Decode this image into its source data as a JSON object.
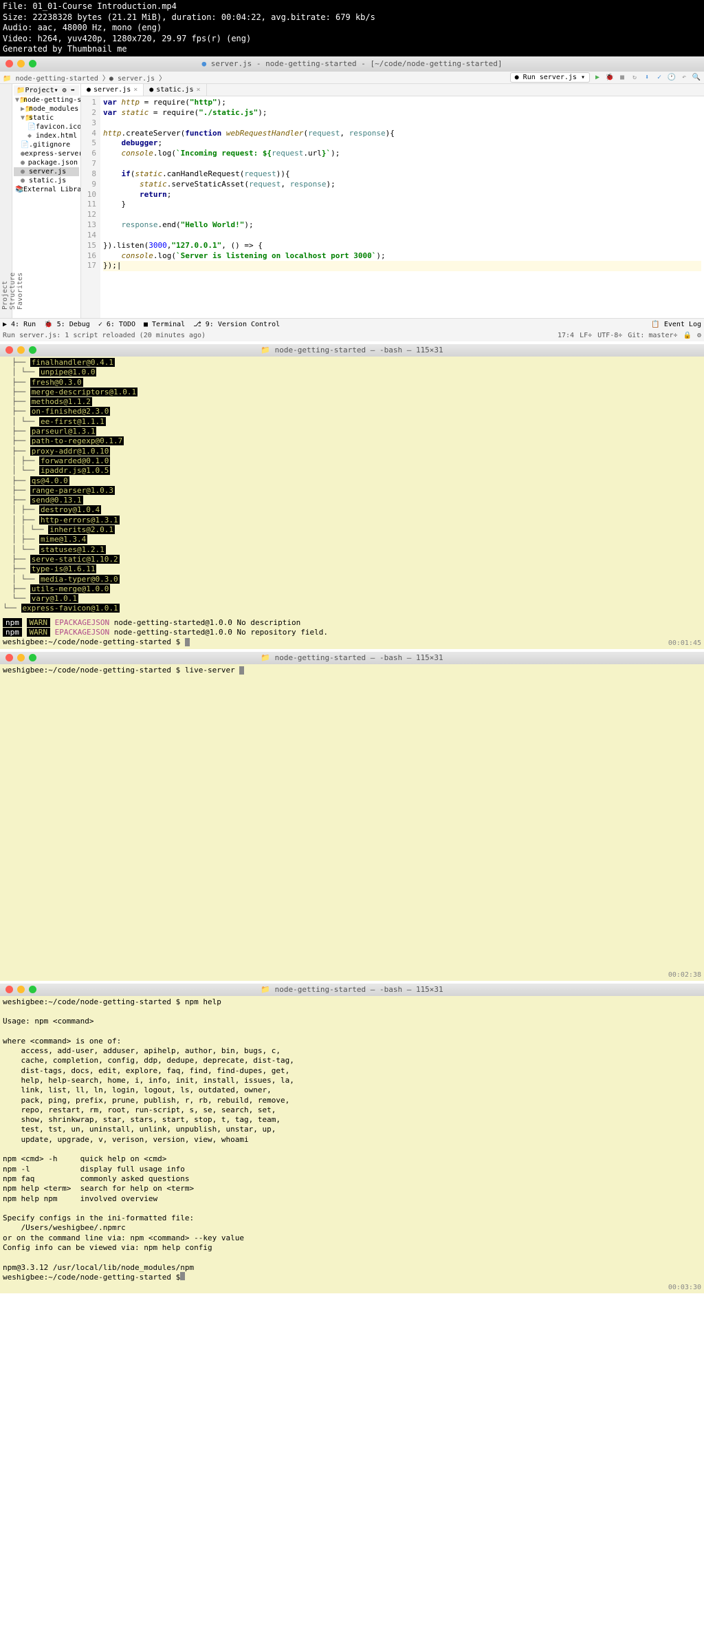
{
  "header": {
    "file": "File: 01_01-Course Introduction.mp4",
    "size": "Size: 22238328 bytes (21.21 MiB), duration: 00:04:22, avg.bitrate: 679 kb/s",
    "audio": "Audio: aac, 48000 Hz, mono (eng)",
    "video": "Video: h264, yuv420p, 1280x720, 29.97 fps(r) (eng)",
    "gen": "Generated by Thumbnail me"
  },
  "ide": {
    "title": "server.js - node-getting-started - [~/code/node-getting-started]",
    "breadcrumb": {
      "project": "node-getting-started",
      "file": "server.js"
    },
    "run_config": "Run server.js",
    "sidebar_tabs": [
      "Project",
      "Structure",
      "Favorites"
    ],
    "tree_header": "Project",
    "tree": [
      {
        "label": "node-getting-sta",
        "indent": 0,
        "type": "folder",
        "expand": "▼"
      },
      {
        "label": "node_modules",
        "indent": 1,
        "type": "folder",
        "expand": "▶"
      },
      {
        "label": "static",
        "indent": 1,
        "type": "folder",
        "expand": "▼"
      },
      {
        "label": "favicon.ico",
        "indent": 2,
        "type": "file"
      },
      {
        "label": "index.html",
        "indent": 2,
        "type": "html"
      },
      {
        "label": ".gitignore",
        "indent": 1,
        "type": "file"
      },
      {
        "label": "express-server",
        "indent": 1,
        "type": "js"
      },
      {
        "label": "package.json",
        "indent": 1,
        "type": "js"
      },
      {
        "label": "server.js",
        "indent": 1,
        "type": "js",
        "selected": true
      },
      {
        "label": "static.js",
        "indent": 1,
        "type": "js"
      },
      {
        "label": "External Libraries",
        "indent": 0,
        "type": "lib"
      }
    ],
    "editor_tabs": [
      {
        "label": "server.js",
        "active": true
      },
      {
        "label": "static.js",
        "active": false
      }
    ],
    "code": [
      {
        "n": 1,
        "html": "<span class='kw'>var</span> <span class='fn'>http</span> = require(<span class='str'>\"http\"</span>);"
      },
      {
        "n": 2,
        "html": "<span class='kw'>var</span> <span class='fn'>static</span> = require(<span class='str'>\"./static.js\"</span>);"
      },
      {
        "n": 3,
        "html": ""
      },
      {
        "n": 4,
        "html": "<span class='fn'>http</span>.createServer(<span class='kw'>function</span> <span class='fn'>webRequestHandler</span>(<span class='param'>request</span>, <span class='param'>response</span>){"
      },
      {
        "n": 5,
        "html": "    <span class='kw'>debugger</span>;"
      },
      {
        "n": 6,
        "html": "    <span class='fn'>console</span>.log(<span class='str'>`Incoming request: ${</span><span class='param'>request</span>.url<span class='str'>}`</span>);"
      },
      {
        "n": 7,
        "html": ""
      },
      {
        "n": 8,
        "html": "    <span class='kw'>if</span>(<span class='fn'>static</span>.canHandleRequest(<span class='param'>request</span>)){"
      },
      {
        "n": 9,
        "html": "        <span class='fn'>static</span>.serveStaticAsset(<span class='param'>request</span>, <span class='param'>response</span>);"
      },
      {
        "n": 10,
        "html": "        <span class='kw'>return</span>;"
      },
      {
        "n": 11,
        "html": "    }"
      },
      {
        "n": 12,
        "html": ""
      },
      {
        "n": 13,
        "html": "    <span class='param'>response</span>.end(<span class='str'>\"Hello World!\"</span>);"
      },
      {
        "n": 14,
        "html": ""
      },
      {
        "n": 15,
        "html": "}).listen(<span style='color:#0000ff'>3000</span>,<span class='str'>\"127.0.0.1\"</span>, () => {"
      },
      {
        "n": 16,
        "html": "    <span class='fn'>console</span>.log(<span class='str'>`Server is listening on localhost port 3000`</span>);"
      },
      {
        "n": 17,
        "html": "});|",
        "current": true
      }
    ],
    "bottom_tabs": [
      "▶ 4: Run",
      "🐞 5: Debug",
      "✓ 6: TODO",
      "■ Terminal",
      "⎇ 9: Version Control"
    ],
    "event_log": "Event Log",
    "status_left": "Run server.js: 1 script reloaded (20 minutes ago)",
    "status_right": [
      "17:4",
      "LF÷",
      "UTF-8÷",
      "Git: master÷",
      "🔒",
      "⚙"
    ]
  },
  "term1": {
    "title": "node-getting-started — -bash — 115×31",
    "tree": [
      {
        "prefix": "  ├── ",
        "pkg": "finalhandler@0.4.1"
      },
      {
        "prefix": "  │ └── ",
        "pkg": "unpipe@1.0.0"
      },
      {
        "prefix": "  ├── ",
        "pkg": "fresh@0.3.0"
      },
      {
        "prefix": "  ├── ",
        "pkg": "merge-descriptors@1.0.1"
      },
      {
        "prefix": "  ├── ",
        "pkg": "methods@1.1.2"
      },
      {
        "prefix": "  ├── ",
        "pkg": "on-finished@2.3.0"
      },
      {
        "prefix": "  │ └── ",
        "pkg": "ee-first@1.1.1"
      },
      {
        "prefix": "  ├── ",
        "pkg": "parseurl@1.3.1"
      },
      {
        "prefix": "  ├── ",
        "pkg": "path-to-regexp@0.1.7"
      },
      {
        "prefix": "  ├── ",
        "pkg": "proxy-addr@1.0.10"
      },
      {
        "prefix": "  │ ├── ",
        "pkg": "forwarded@0.1.0"
      },
      {
        "prefix": "  │ └── ",
        "pkg": "ipaddr.js@1.0.5"
      },
      {
        "prefix": "  ├── ",
        "pkg": "qs@4.0.0"
      },
      {
        "prefix": "  ├── ",
        "pkg": "range-parser@1.0.3"
      },
      {
        "prefix": "  ├── ",
        "pkg": "send@0.13.1"
      },
      {
        "prefix": "  │ ├── ",
        "pkg": "destroy@1.0.4"
      },
      {
        "prefix": "  │ ├── ",
        "pkg": "http-errors@1.3.1"
      },
      {
        "prefix": "  │ │ └── ",
        "pkg": "inherits@2.0.1"
      },
      {
        "prefix": "  │ ├── ",
        "pkg": "mime@1.3.4"
      },
      {
        "prefix": "  │ └── ",
        "pkg": "statuses@1.2.1"
      },
      {
        "prefix": "  ├── ",
        "pkg": "serve-static@1.10.2"
      },
      {
        "prefix": "  ├── ",
        "pkg": "type-is@1.6.11"
      },
      {
        "prefix": "  │ └── ",
        "pkg": "media-typer@0.3.0"
      },
      {
        "prefix": "  ├── ",
        "pkg": "utils-merge@1.0.0"
      },
      {
        "prefix": "  └── ",
        "pkg": "vary@1.0.1"
      },
      {
        "prefix": "└── ",
        "pkg": "express-favicon@1.0.1"
      }
    ],
    "warn1": "node-getting-started@1.0.0 No description",
    "warn2": "node-getting-started@1.0.0 No repository field.",
    "prompt": "weshigbee:~/code/node-getting-started $ ",
    "timestamp": "00:01:45"
  },
  "term2": {
    "title": "node-getting-started — -bash — 115×31",
    "prompt": "weshigbee:~/code/node-getting-started $ ",
    "command": "live-server ",
    "timestamp": "00:02:38"
  },
  "term3": {
    "title": "node-getting-started — -bash — 115×31",
    "content": "weshigbee:~/code/node-getting-started $ npm help\n\nUsage: npm <command>\n\nwhere <command> is one of:\n    access, add-user, adduser, apihelp, author, bin, bugs, c,\n    cache, completion, config, ddp, dedupe, deprecate, dist-tag,\n    dist-tags, docs, edit, explore, faq, find, find-dupes, get,\n    help, help-search, home, i, info, init, install, issues, la,\n    link, list, ll, ln, login, logout, ls, outdated, owner,\n    pack, ping, prefix, prune, publish, r, rb, rebuild, remove,\n    repo, restart, rm, root, run-script, s, se, search, set,\n    show, shrinkwrap, star, stars, start, stop, t, tag, team,\n    test, tst, un, uninstall, unlink, unpublish, unstar, up,\n    update, upgrade, v, verison, version, view, whoami\n\nnpm <cmd> -h     quick help on <cmd>\nnpm -l           display full usage info\nnpm faq          commonly asked questions\nnpm help <term>  search for help on <term>\nnpm help npm     involved overview\n\nSpecify configs in the ini-formatted file:\n    /Users/weshigbee/.npmrc\nor on the command line via: npm <command> --key value\nConfig info can be viewed via: npm help config\n\nnpm@3.3.12 /usr/local/lib/node_modules/npm\nweshigbee:~/code/node-getting-started $ ",
    "timestamp": "00:03:30"
  }
}
